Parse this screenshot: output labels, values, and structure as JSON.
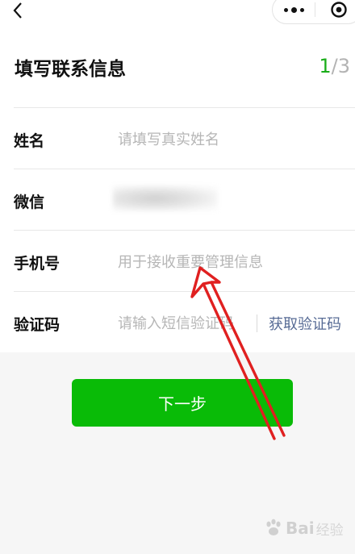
{
  "header": {
    "title": "填写联系信息",
    "step_current": "1",
    "step_total": "/3"
  },
  "fields": [
    {
      "label": "姓名",
      "placeholder": "请填写真实姓名"
    },
    {
      "label": "微信",
      "value": ""
    },
    {
      "label": "手机号",
      "placeholder": "用于接收重要管理信息"
    },
    {
      "label": "验证码",
      "placeholder": "请输入短信验证码"
    }
  ],
  "get_code_label": "获取验证码",
  "next_button_label": "下一步",
  "watermark": {
    "brand": "Bai",
    "suffix": "经验"
  },
  "colors": {
    "accent_green": "#09bb07",
    "step_green": "#1aad19",
    "link_blue": "#576b95",
    "annotation_red": "#e02020"
  }
}
